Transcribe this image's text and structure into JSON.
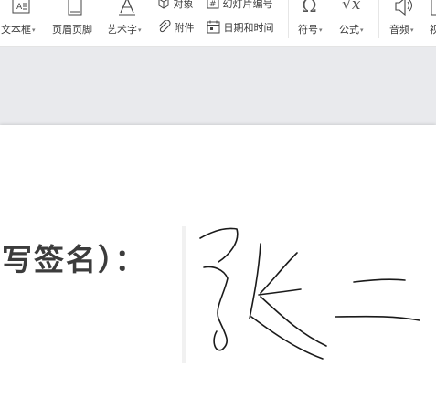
{
  "ribbon": {
    "text_box": "文本框",
    "header_footer": "页眉页脚",
    "art_text": "艺术字",
    "object": "对象",
    "attachment": "附件",
    "slide_number": "幻灯片编号",
    "date_time": "日期和时间",
    "symbol": "符号",
    "formula": "公式",
    "audio": "音频",
    "video_partial": "视",
    "dropdown_caret": "▾"
  },
  "icons": {
    "text_box": "text-box-icon",
    "header_footer": "header-footer-icon",
    "art_text": "art-text-icon",
    "object": "object-icon",
    "slide_number": "slide-number-icon",
    "attachment": "paperclip-icon",
    "date_time": "calendar-icon",
    "symbol": "omega-icon",
    "formula": "formula-icon",
    "audio": "speaker-icon"
  },
  "slide": {
    "prompt_text": "写签名）："
  },
  "colors": {
    "workspace_bg": "#e9eaed",
    "ribbon_text": "#3a3a3a",
    "ink": "#1a1a1a"
  }
}
